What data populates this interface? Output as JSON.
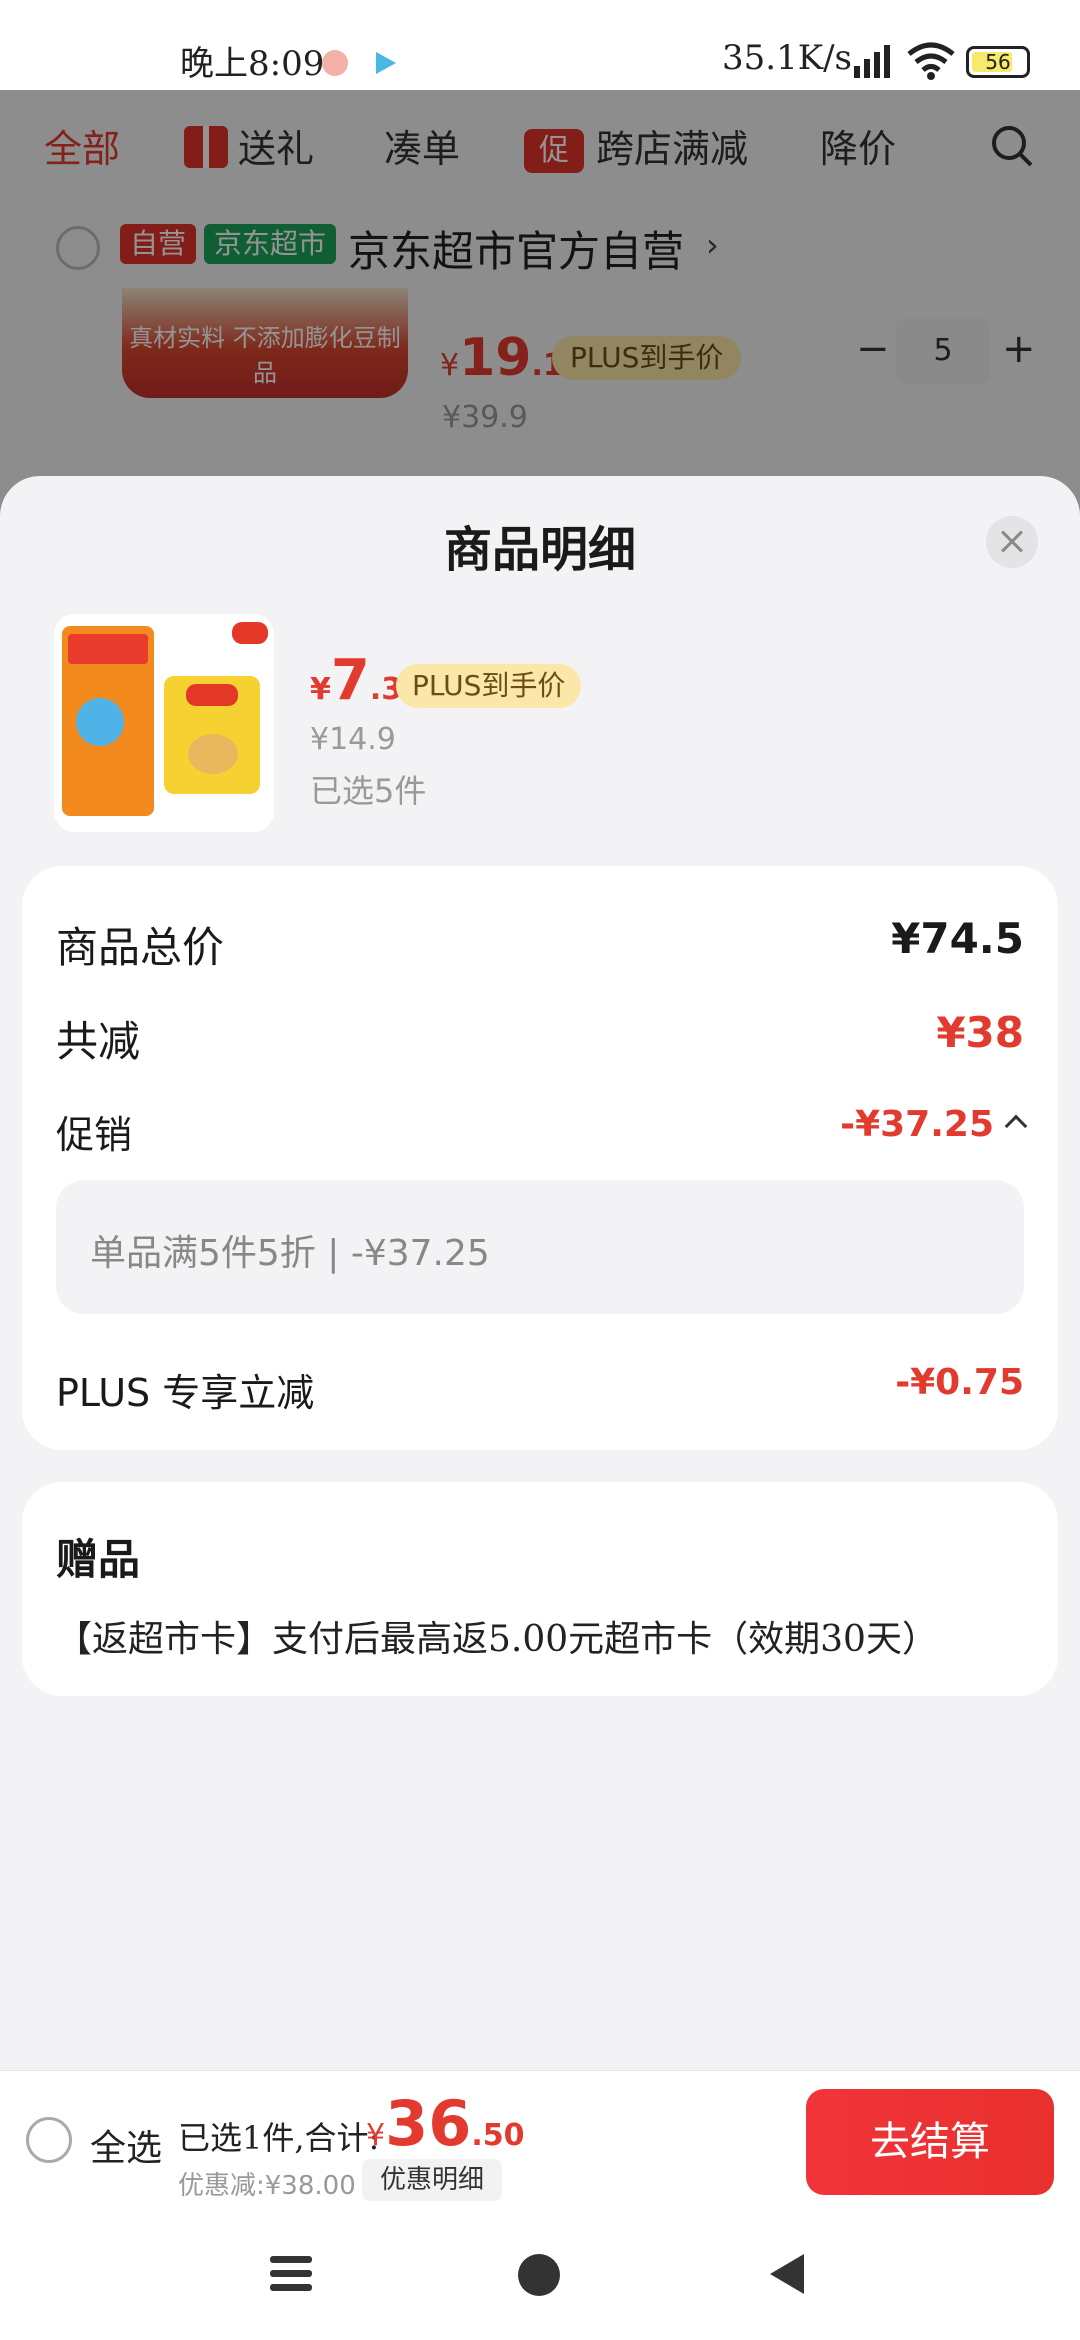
{
  "status_bar": {
    "time": "晚上8:09",
    "network_speed": "35.1K/s",
    "battery": "56"
  },
  "background_page": {
    "tabs": [
      {
        "label": "全部",
        "active": true
      },
      {
        "label": "送礼",
        "icon": "gift-icon"
      },
      {
        "label": "凑单"
      },
      {
        "label": "跨店满减",
        "icon_text": "促"
      },
      {
        "label": "降价"
      }
    ],
    "shop": {
      "badge_self": "自营",
      "badge_market": "京东超市",
      "name": "京东超市官方自营",
      "chevron": "›"
    },
    "item": {
      "image_caption": "真材实料 不添加膨化豆制品",
      "price_yen": "¥",
      "price_int": "19",
      "price_dec": ".1",
      "plus_tag": "PLUS到手价",
      "original_price": "¥39.9",
      "quantity": "5",
      "minus": "−",
      "plus": "+"
    }
  },
  "sheet": {
    "title": "商品明细",
    "product": {
      "price_yen": "¥",
      "price_int": "7",
      "price_dec": ".3",
      "plus_tag": "PLUS到手价",
      "original_price": "¥14.9",
      "selected_count": "已选5件"
    },
    "price_card": {
      "total_label": "商品总价",
      "total_value": "¥74.5",
      "reduce_label": "共减",
      "reduce_value": "¥38",
      "promo_label": "促销",
      "promo_value": "-¥37.25",
      "promo_detail": "单品满5件5折 | -¥37.25",
      "plus_label": "PLUS 专享立减",
      "plus_value": "-¥0.75"
    },
    "gift_card": {
      "title": "赠品",
      "text": "【返超市卡】支付后最高返5.00元超市卡（效期30天）"
    }
  },
  "checkout_bar": {
    "select_all": "全选",
    "summary": "已选1件,合计:",
    "total_yen": "¥",
    "total_int": "36",
    "total_dec": ".50",
    "discount": "优惠减:¥38.00",
    "discount_detail_button": "优惠明细",
    "checkout_button": "去结算"
  },
  "colors": {
    "accent_red": "#e23a2e",
    "plus_tag_bg": "#fbe7a8",
    "jd_market_green": "#1aa35a"
  }
}
